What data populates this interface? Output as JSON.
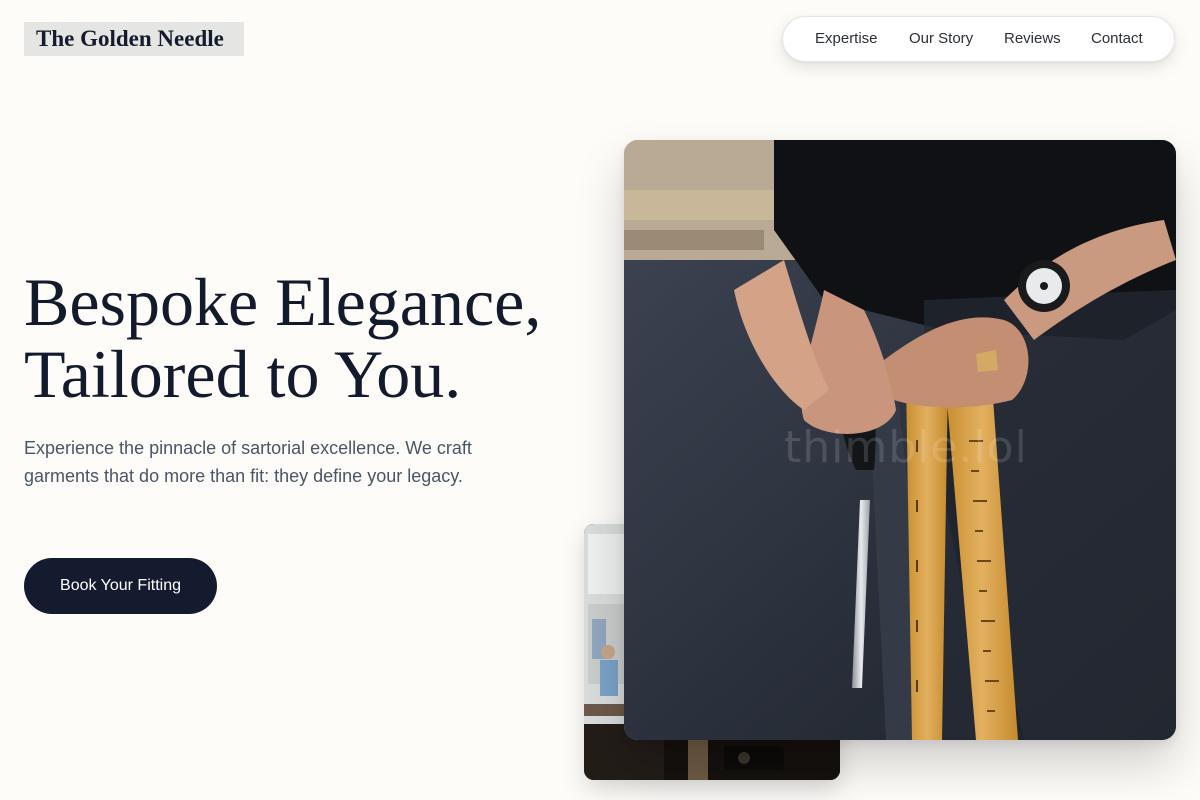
{
  "brand": {
    "name": "The Golden Needle"
  },
  "nav": {
    "items": [
      {
        "label": "Expertise"
      },
      {
        "label": "Our Story"
      },
      {
        "label": "Reviews"
      },
      {
        "label": "Contact"
      }
    ]
  },
  "hero": {
    "headline_line1": "Bespoke Elegance,",
    "headline_line2": "Tailored to You.",
    "description": "Experience the pinnacle of sartorial excellence. We craft garments that do more than fit: they define your legacy.",
    "cta_label": "Book Your Fitting"
  },
  "images": {
    "main_alt": "Tailor cutting dark suit fabric with scissors beside a yellow measuring tape",
    "secondary_alt": "Tailoring workshop interior with a sewing machine",
    "watermark": "thimble.lol"
  },
  "colors": {
    "page_background": "#fdfcf9",
    "primary_dark": "#141b2f",
    "body_text": "#4b5565",
    "tape_yellow": "#d9a441"
  }
}
